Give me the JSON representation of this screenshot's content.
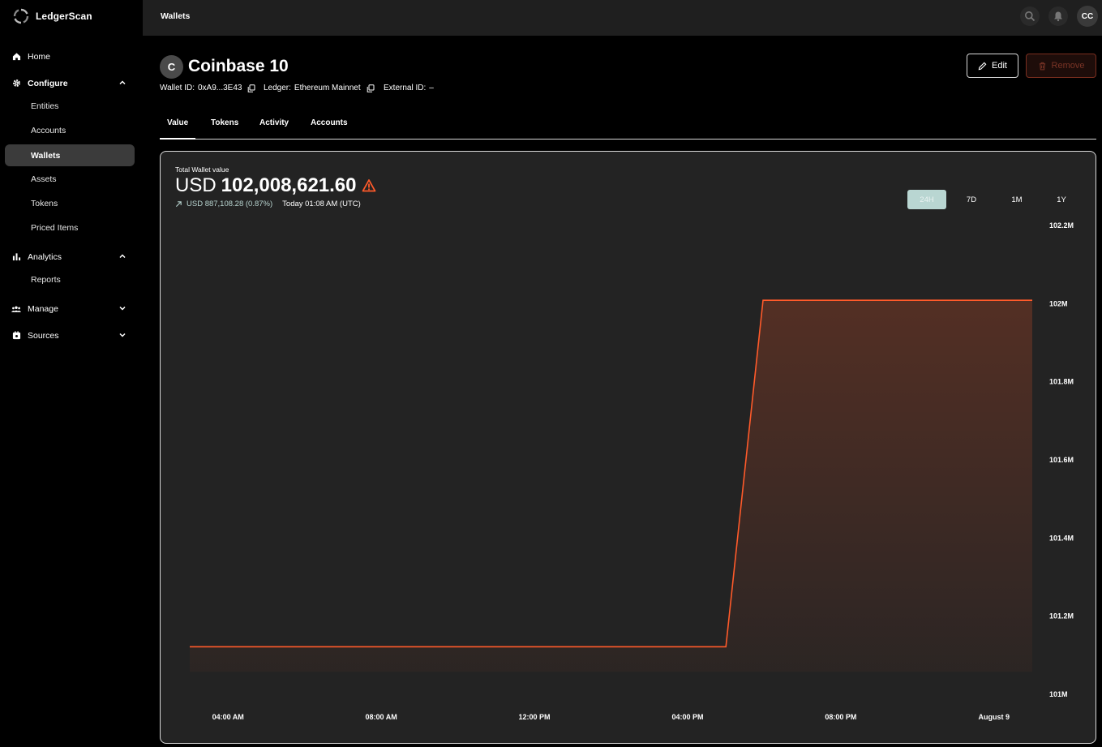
{
  "app": {
    "name": "LedgerScan"
  },
  "topbar": {
    "title": "Wallets",
    "avatar_initials": "CC"
  },
  "sidebar": {
    "home": "Home",
    "configure": "Configure",
    "configure_items": [
      "Entities",
      "Accounts",
      "Wallets",
      "Assets",
      "Tokens",
      "Priced Items"
    ],
    "analytics": "Analytics",
    "analytics_items": [
      "Reports"
    ],
    "manage": "Manage",
    "sources": "Sources"
  },
  "wallet": {
    "avatar_letter": "C",
    "name": "Coinbase 10",
    "wallet_id_label": "Wallet ID:",
    "wallet_id": "0xA9...3E43",
    "ledger_label": "Ledger:",
    "ledger": "Ethereum Mainnet",
    "external_id_label": "External ID:",
    "external_id": "–"
  },
  "actions": {
    "edit": "Edit",
    "remove": "Remove"
  },
  "tabs": [
    "Value",
    "Tokens",
    "Activity",
    "Accounts"
  ],
  "summary": {
    "label": "Total Wallet value",
    "currency": "USD",
    "value": "102,008,621.60",
    "change": "USD 887,108.28 (0.87%)",
    "timestamp": "Today 01:08 AM (UTC)"
  },
  "ranges": [
    "24H",
    "7D",
    "1M",
    "1Y"
  ],
  "active_range": "24H",
  "colors": {
    "line": "#ff5a2a",
    "active_range": "#b9d6d2"
  },
  "chart_data": {
    "type": "area",
    "x_ticks": [
      "04:00 AM",
      "08:00 AM",
      "12:00 PM",
      "04:00 PM",
      "08:00 PM",
      "August 9"
    ],
    "y_ticks": [
      "101M",
      "101.2M",
      "101.4M",
      "101.6M",
      "101.8M",
      "102M",
      "102.2M"
    ],
    "ylim": [
      101000000,
      102200000
    ],
    "x_hours": [
      3.0,
      17.0,
      17.97,
      25.0
    ],
    "x_labels_hours": [
      4,
      8,
      12,
      16,
      20,
      24
    ],
    "y": [
      101121500,
      101121500,
      102008621.6,
      102008621.6
    ],
    "xlim_hours": [
      3.0,
      25.0
    ]
  }
}
